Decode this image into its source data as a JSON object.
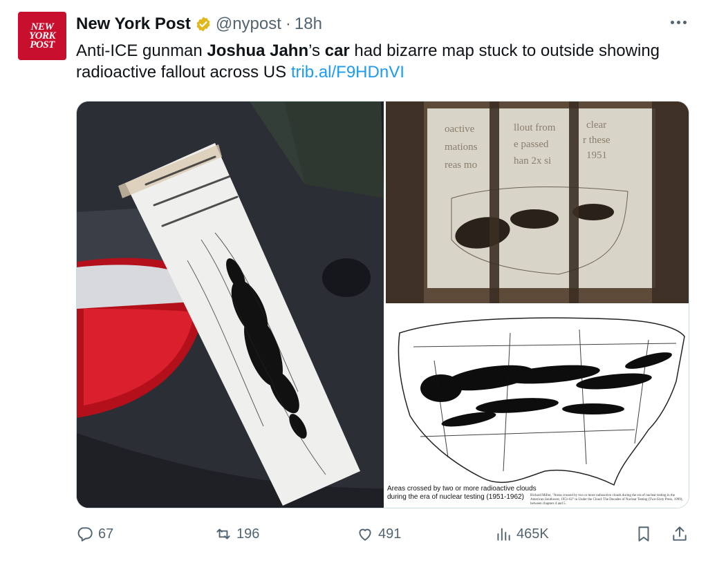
{
  "author": {
    "avatar_lines": [
      "NEW",
      "YORK",
      "POST"
    ],
    "display_name": "New York Post",
    "handle": "@nypost",
    "separator": "·",
    "time": "18h"
  },
  "tweet": {
    "text_1": "Anti-ICE gunman ",
    "bold_1": "Joshua Jahn",
    "text_2": "’s ",
    "bold_2": "car",
    "text_3": " had bizarre map stuck to outside showing radioactive fallout across US ",
    "link": "trib.al/F9HDnVI"
  },
  "media": {
    "left_photo_sign": "Radioactive fallout from nuclear detonations have passed over these areas more than 2x since 1951",
    "top_right_sign": [
      "oactive",
      "llout from",
      "clear",
      "mations",
      "e passed",
      "r these",
      "reas mo",
      "han 2x si",
      "1951"
    ],
    "map_caption": [
      "Areas crossed by two or more radioactive clouds",
      "during the era of nuclear testing (1951-1962)"
    ],
    "map_credit": "Richard Miller, \"Areas crossed by two or more radioactive clouds during the era of nuclear testing in the American Southwest, 1951-62\" in Under the Cloud: The Decades of Nuclear Testing (Two-Sixty Press, 1999), between chapters 4 and 5."
  },
  "actions": {
    "replies": "67",
    "reposts": "196",
    "likes": "491",
    "views": "465K"
  },
  "colors": {
    "brand_red": "#c8102e",
    "verified_gold": "#e2b719",
    "link_blue": "#1d9bf0",
    "muted_gray": "#536471"
  }
}
